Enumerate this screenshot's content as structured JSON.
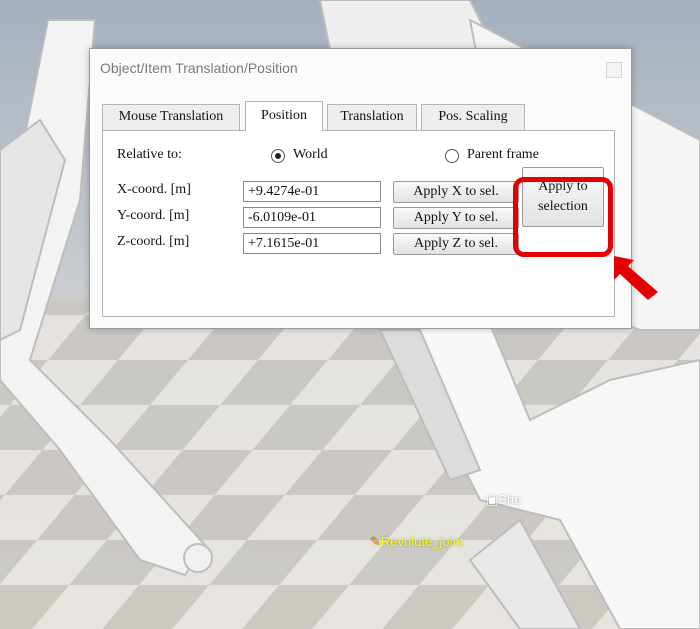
{
  "dialog": {
    "title": "Object/Item Translation/Position",
    "close_icon": "close-icon"
  },
  "tabs": [
    {
      "label": "Mouse Translation",
      "active": false
    },
    {
      "label": "Position",
      "active": true
    },
    {
      "label": "Translation",
      "active": false
    },
    {
      "label": "Pos. Scaling",
      "active": false
    }
  ],
  "relative_to": {
    "label": "Relative to:",
    "options": [
      {
        "label": "World",
        "selected": true
      },
      {
        "label": "Parent frame",
        "selected": false
      }
    ]
  },
  "coords": [
    {
      "label": "X-coord. [m]",
      "value": "+9.4274e-01",
      "button": "Apply X to sel."
    },
    {
      "label": "Y-coord. [m]",
      "value": "-6.0109e-01",
      "button": "Apply Y to sel."
    },
    {
      "label": "Z-coord. [m]",
      "value": "+7.1615e-01",
      "button": "Apply Z to sel."
    }
  ],
  "apply_selection": {
    "line1": "Apply to",
    "line2": "selection"
  },
  "annotation": {
    "highlight_color": "#e40000",
    "arrow_icon": "arrow-pointer-icon"
  },
  "scene": {
    "joint_label": "Revolute_joint",
    "object_label": "Sho",
    "joint_icon": "pencil-icon",
    "object_icon": "shape-icon"
  }
}
